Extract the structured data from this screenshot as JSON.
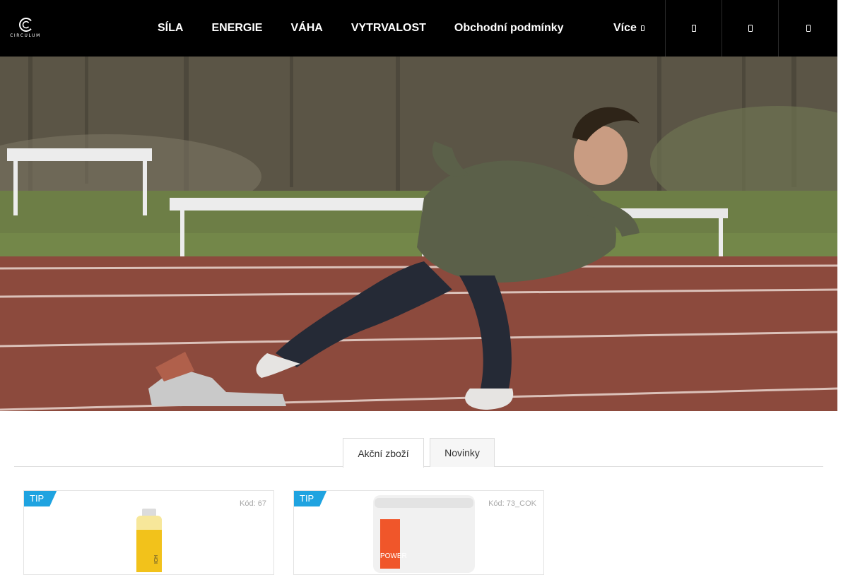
{
  "brand": {
    "logo_text": "CIRCULUM"
  },
  "nav": {
    "items": [
      {
        "label": "SÍLA"
      },
      {
        "label": "ENERGIE"
      },
      {
        "label": "VÁHA"
      },
      {
        "label": "VYTRVALOST"
      },
      {
        "label": "Obchodní podmínky"
      }
    ],
    "more_label": "Více"
  },
  "header_icons": [
    {
      "icon": "search-icon"
    },
    {
      "icon": "user-icon"
    },
    {
      "icon": "cart-icon"
    }
  ],
  "tabs": [
    {
      "label": "Akční zboží",
      "active": true
    },
    {
      "label": "Novinky",
      "active": false
    }
  ],
  "products": [
    {
      "badge": "TIP",
      "code_label": "Kód:",
      "code": "67",
      "label_text": "ICH",
      "label_color": "#f2c21b"
    },
    {
      "badge": "TIP",
      "code_label": "Kód:",
      "code": "73_COK",
      "label_text": "POWER",
      "label_color": "#f0562a"
    }
  ],
  "colors": {
    "header_bg": "#000000",
    "badge": "#1fa3e0",
    "border": "#dddddd"
  }
}
